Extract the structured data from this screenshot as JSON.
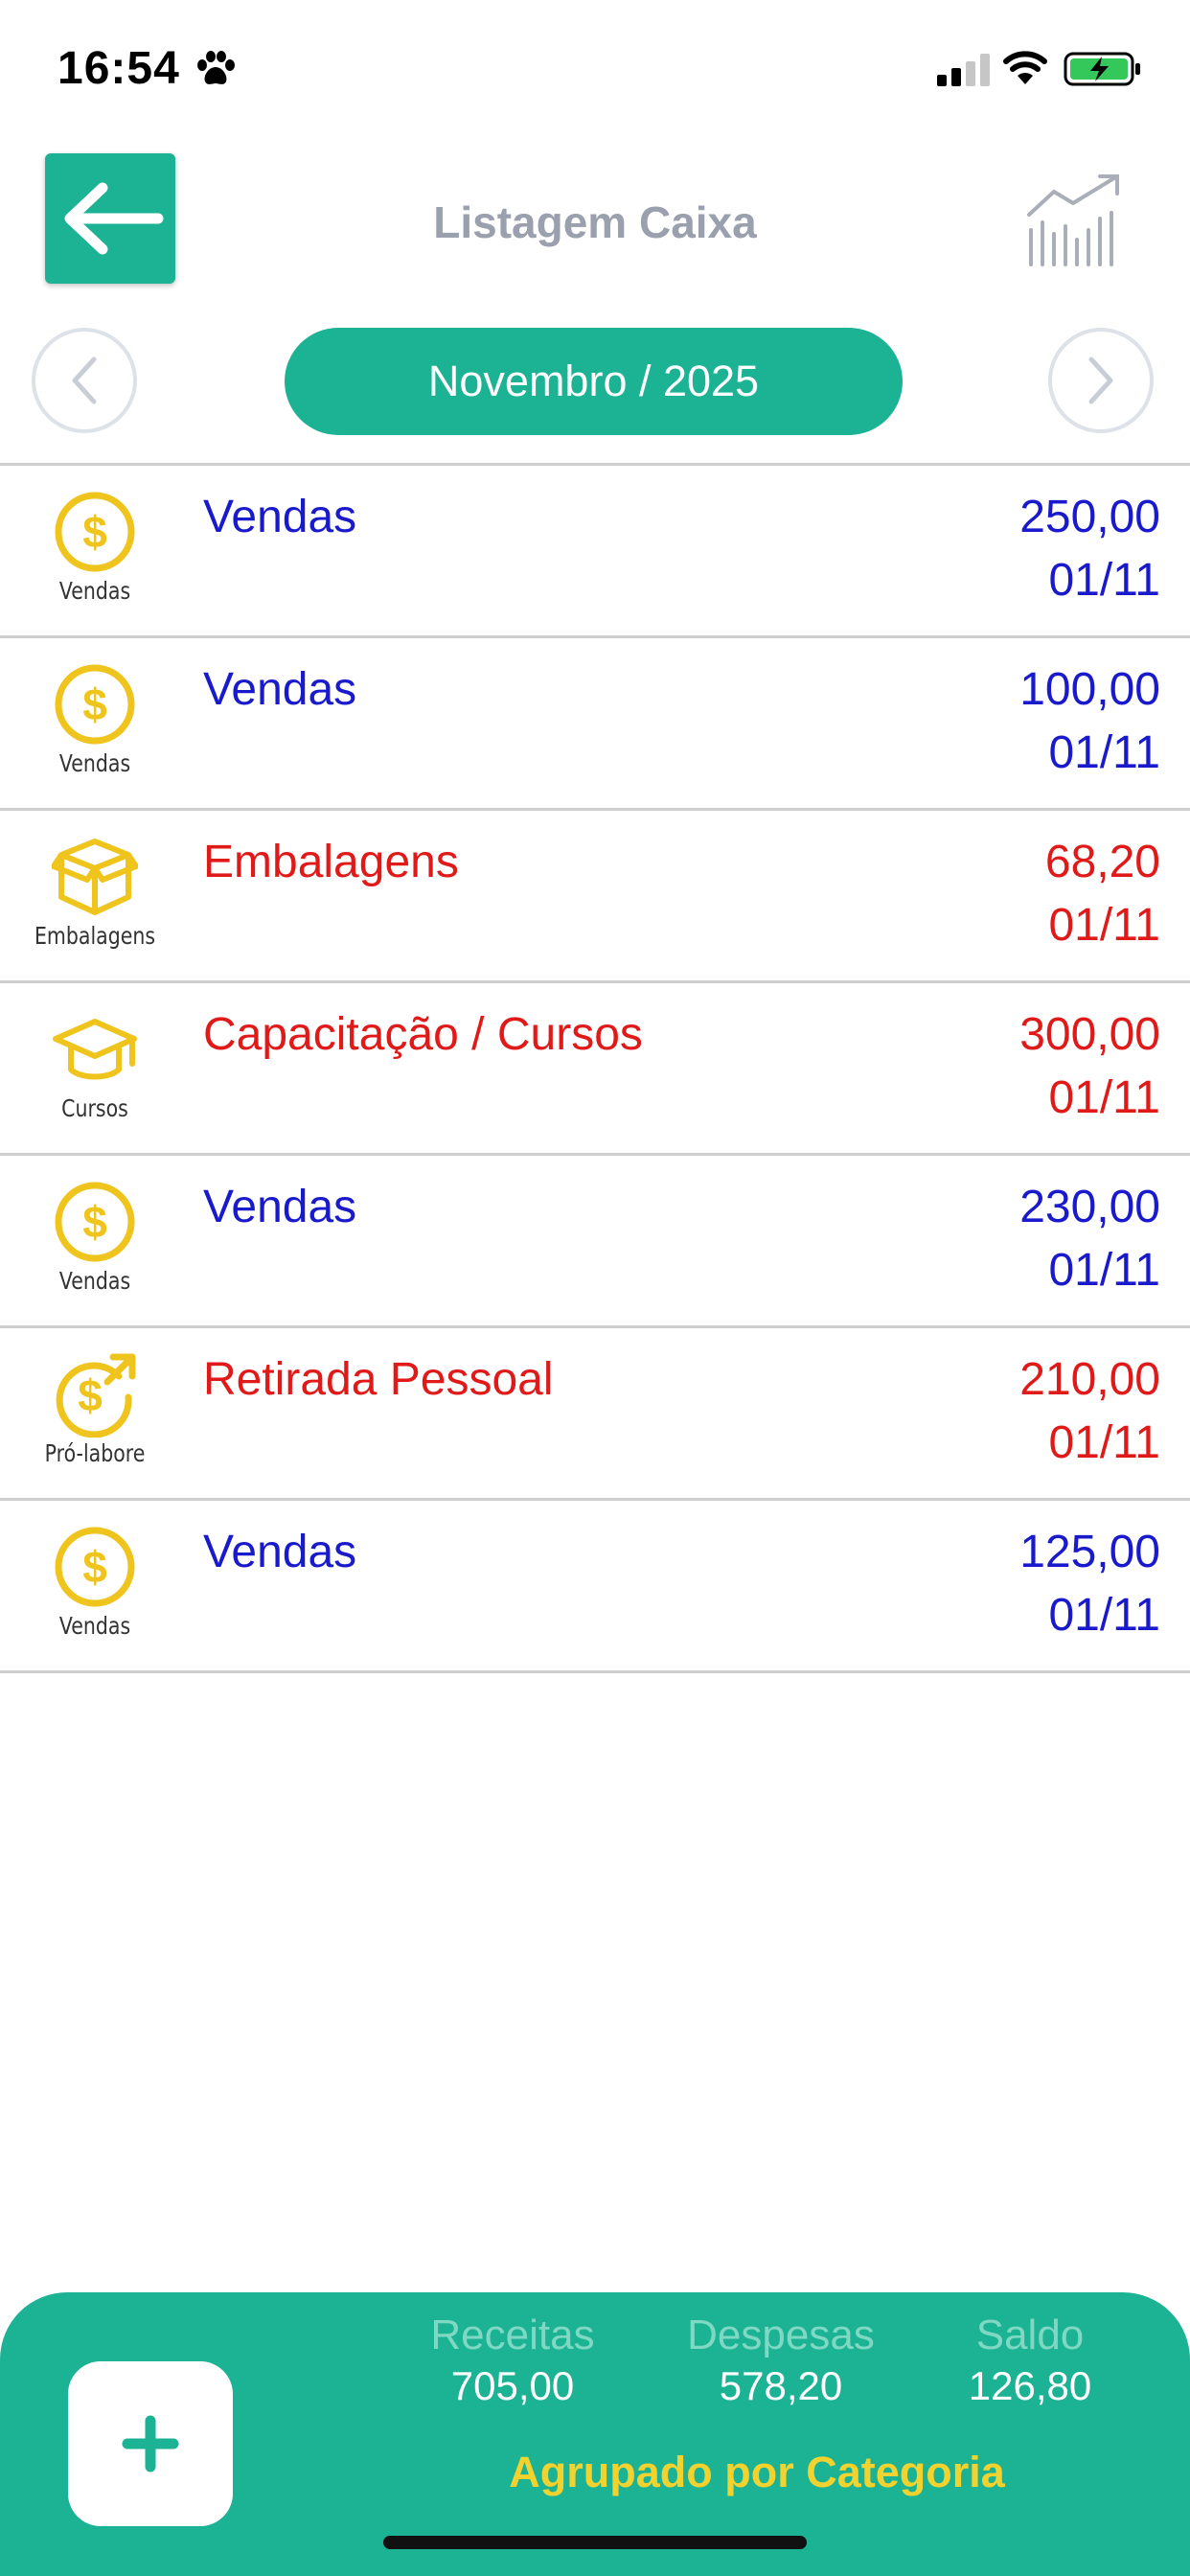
{
  "status_bar": {
    "time": "16:54"
  },
  "header": {
    "title": "Listagem Caixa",
    "month_label": "Novembro / 2025"
  },
  "colors": {
    "accent": "#1bb394",
    "income": "#1a1acd",
    "expense": "#e01919",
    "icon_yellow": "#efc41c",
    "group_label": "#f2d22e"
  },
  "entries": [
    {
      "icon": "dollar-coin-icon",
      "category": "Vendas",
      "description": "Vendas",
      "amount": "250,00",
      "date": "01/11",
      "type": "income"
    },
    {
      "icon": "dollar-coin-icon",
      "category": "Vendas",
      "description": "Vendas",
      "amount": "100,00",
      "date": "01/11",
      "type": "income"
    },
    {
      "icon": "box-icon",
      "category": "Embalagens",
      "description": "Embalagens",
      "amount": "68,20",
      "date": "01/11",
      "type": "expense"
    },
    {
      "icon": "graduation-cap-icon",
      "category": "Cursos",
      "description": "Capacitação / Cursos",
      "amount": "300,00",
      "date": "01/11",
      "type": "expense"
    },
    {
      "icon": "dollar-coin-icon",
      "category": "Vendas",
      "description": "Vendas",
      "amount": "230,00",
      "date": "01/11",
      "type": "income"
    },
    {
      "icon": "dollar-withdraw-icon",
      "category": "Pró-labore",
      "description": "Retirada Pessoal",
      "amount": "210,00",
      "date": "01/11",
      "type": "expense"
    },
    {
      "icon": "dollar-coin-icon",
      "category": "Vendas",
      "description": "Vendas",
      "amount": "125,00",
      "date": "01/11",
      "type": "income"
    }
  ],
  "footer": {
    "receitas_label": "Receitas",
    "receitas_value": "705,00",
    "despesas_label": "Despesas",
    "despesas_value": "578,20",
    "saldo_label": "Saldo",
    "saldo_value": "126,80",
    "group_label": "Agrupado por Categoria"
  }
}
